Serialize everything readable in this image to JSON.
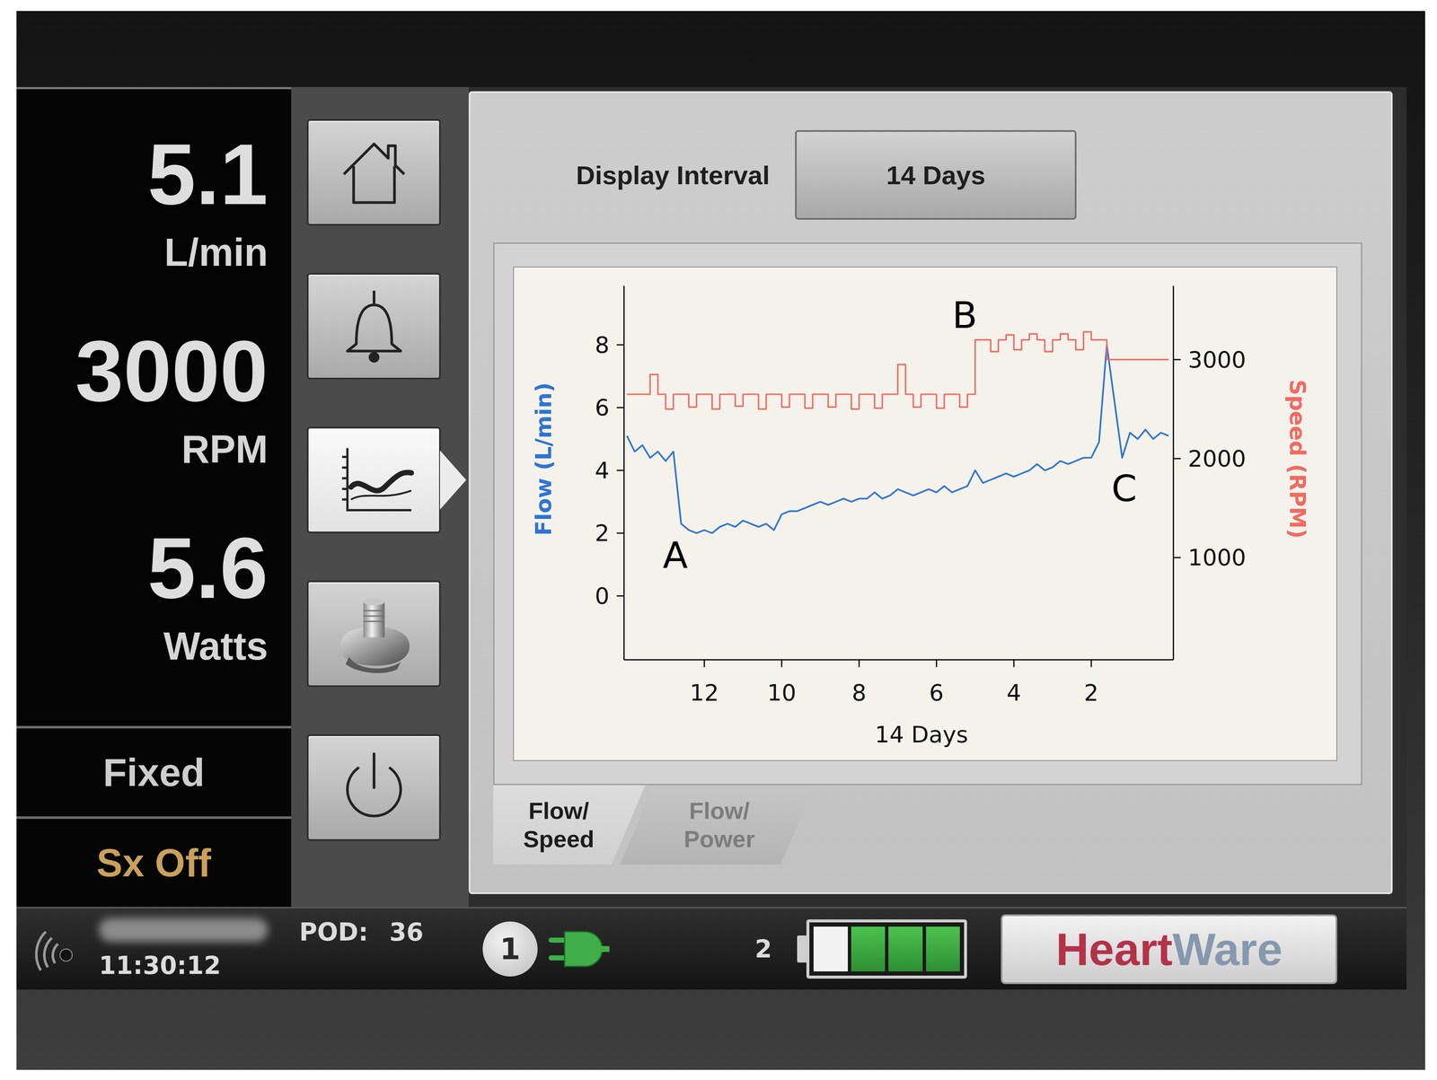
{
  "readings": [
    {
      "value": "5.1",
      "unit": "L/min"
    },
    {
      "value": "3000",
      "unit": "RPM"
    },
    {
      "value": "5.6",
      "unit": "Watts"
    }
  ],
  "mode": "Fixed",
  "suction_detection": "Sx Off",
  "nav": [
    {
      "kind": "home",
      "selected": false
    },
    {
      "kind": "alarms",
      "selected": false
    },
    {
      "kind": "trends",
      "selected": true
    },
    {
      "kind": "pump",
      "selected": false
    },
    {
      "kind": "power",
      "selected": false
    }
  ],
  "display_interval": {
    "label": "Display Interval",
    "value": "14 Days"
  },
  "chart": {
    "left_axis_label": "Flow (L/min)",
    "right_axis_label": "Speed (RPM)",
    "x_axis_label": "14 Days",
    "left_ticks": [
      "0",
      "2",
      "4",
      "6",
      "8"
    ],
    "right_ticks": [
      "1000",
      "2000",
      "3000"
    ],
    "x_ticks": [
      "12",
      "10",
      "8",
      "6",
      "4",
      "2"
    ],
    "annotations": [
      {
        "label": "A",
        "day": 12.75,
        "flow": 1.3
      },
      {
        "label": "B",
        "day": 5.27,
        "flow": 8.95
      },
      {
        "label": "C",
        "day": 1.15,
        "flow": 3.43
      }
    ],
    "series": [
      {
        "name": "Flow",
        "axis": "left",
        "kind": "line",
        "color": "#2f74d0",
        "values": [
          5.1,
          4.6,
          4.8,
          4.4,
          4.6,
          4.3,
          4.6,
          2.3,
          2.1,
          2.0,
          2.1,
          2.0,
          2.2,
          2.3,
          2.2,
          2.4,
          2.3,
          2.2,
          2.3,
          2.1,
          2.6,
          2.7,
          2.7,
          2.8,
          2.9,
          3.0,
          2.9,
          3.0,
          3.1,
          3.0,
          3.1,
          3.1,
          3.3,
          3.1,
          3.2,
          3.4,
          3.3,
          3.2,
          3.3,
          3.4,
          3.3,
          3.5,
          3.3,
          3.4,
          3.5,
          4.0,
          3.6,
          3.7,
          3.8,
          3.9,
          3.8,
          3.9,
          4.0,
          4.2,
          4.0,
          4.1,
          4.3,
          4.2,
          4.3,
          4.4,
          4.4,
          4.9,
          8.0,
          6.2,
          4.4,
          5.2,
          5.0,
          5.3,
          5.0,
          5.2,
          5.1
        ]
      },
      {
        "name": "Speed",
        "axis": "right",
        "kind": "step",
        "color": "#ef6b63",
        "values": [
          2650,
          2650,
          2650,
          2850,
          2650,
          2500,
          2650,
          2650,
          2520,
          2650,
          2650,
          2500,
          2650,
          2650,
          2530,
          2650,
          2650,
          2500,
          2650,
          2650,
          2520,
          2650,
          2650,
          2510,
          2650,
          2650,
          2520,
          2650,
          2650,
          2500,
          2650,
          2650,
          2510,
          2650,
          2650,
          2950,
          2650,
          2520,
          2650,
          2650,
          2510,
          2650,
          2650,
          2520,
          2650,
          3200,
          3200,
          3080,
          3200,
          3250,
          3100,
          3200,
          3260,
          3200,
          3080,
          3200,
          3260,
          3200,
          3100,
          3280,
          3200,
          3200,
          3000,
          3000,
          3000,
          3000,
          3000,
          3000,
          3000,
          3000,
          3000
        ]
      }
    ]
  },
  "tabs": [
    {
      "lines": [
        "Flow/",
        "Speed"
      ],
      "selected": true
    },
    {
      "lines": [
        "Flow/",
        "Power"
      ],
      "selected": false
    }
  ],
  "status_bar": {
    "time": "11:30:12",
    "pod_label": "POD:",
    "pod_value": "36",
    "power_port": "1",
    "battery_port": "2",
    "battery_level": 0.75,
    "logo": {
      "first": "Heart",
      "second": "Ware"
    }
  }
}
